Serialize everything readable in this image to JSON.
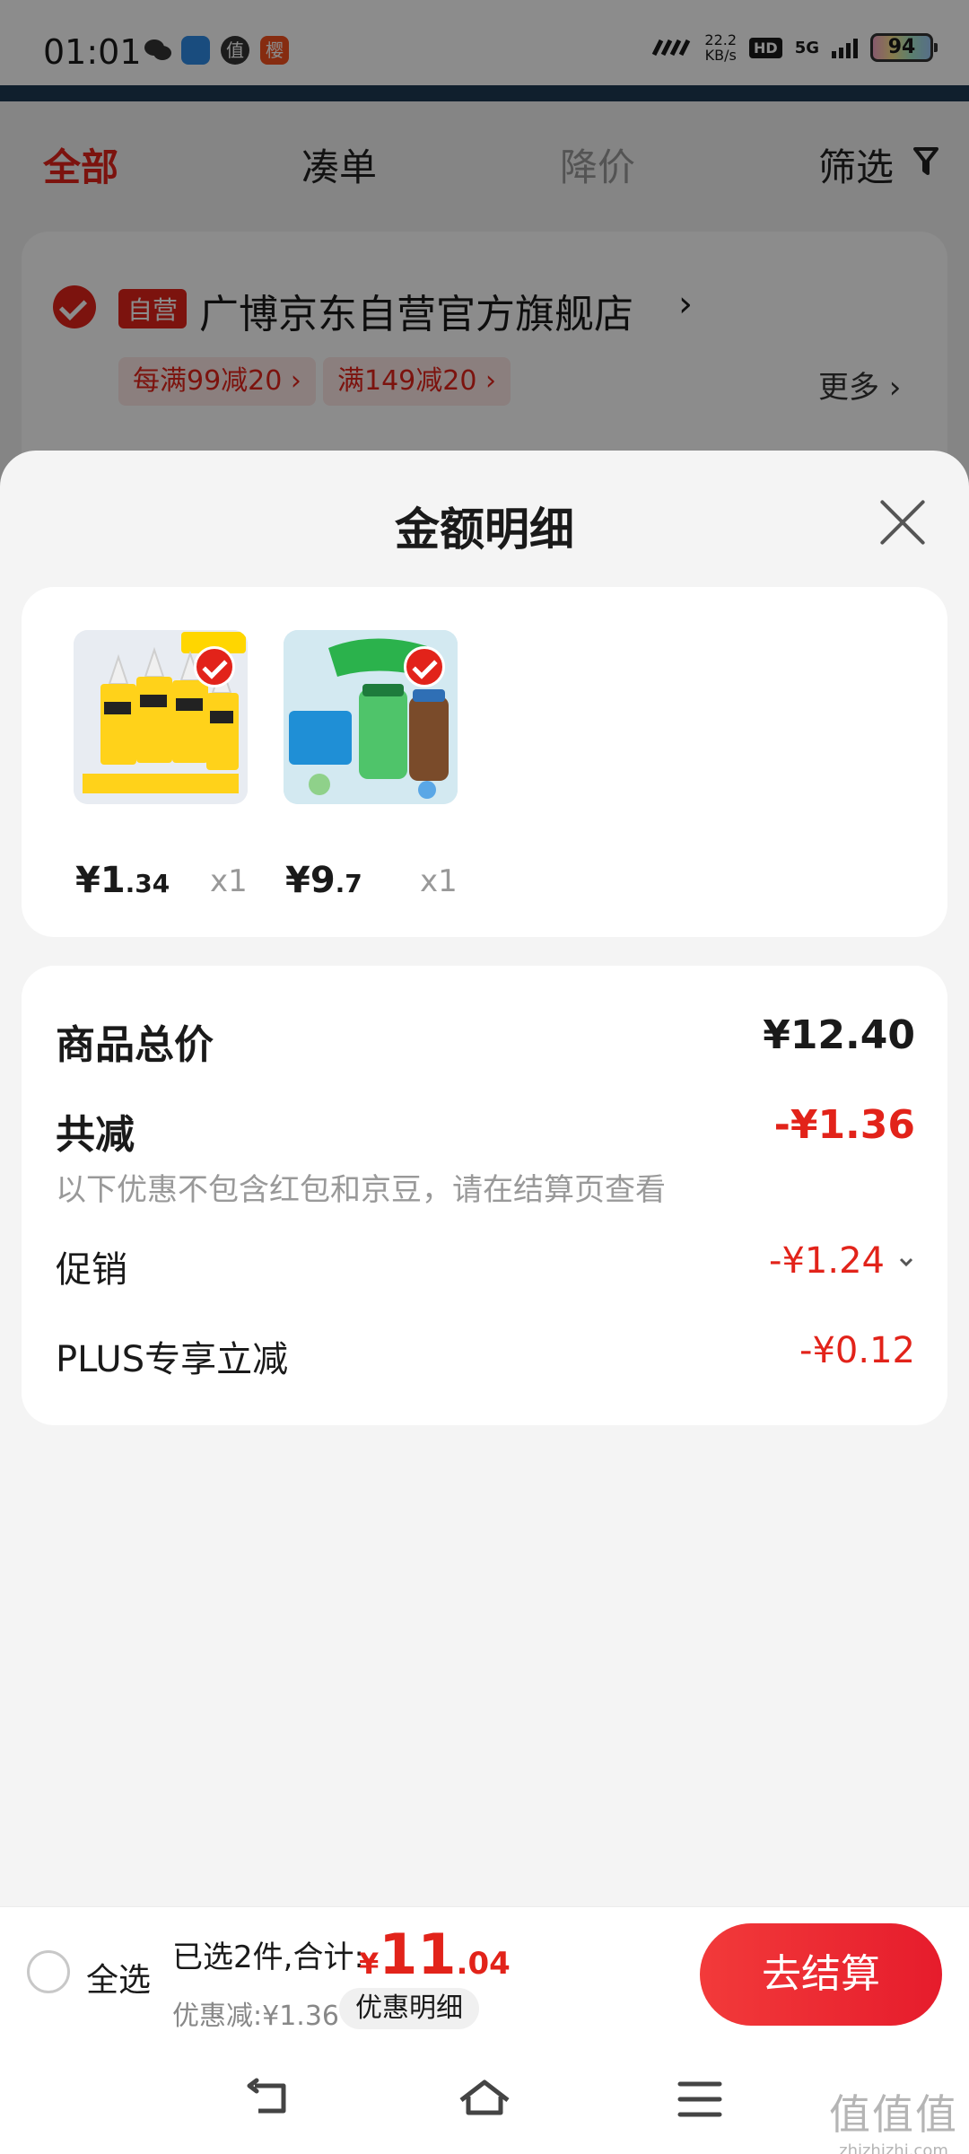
{
  "status_bar": {
    "time": "01:01",
    "net_speed_value": "22.2",
    "net_speed_unit": "KB/s",
    "hd": "HD",
    "network": "5G",
    "battery": "94",
    "app_icons": [
      "wechat-icon",
      "app-icon",
      "zhi-icon",
      "cherry-icon"
    ],
    "zhi_char": "值",
    "cherry_char": "樱"
  },
  "tabs": {
    "all": "全部",
    "combine": "凑单",
    "price_drop": "降价",
    "filter": "筛选"
  },
  "store": {
    "self_tag": "自营",
    "name": "广博京东自营官方旗舰店",
    "chevron": "›",
    "promo1": "每满99减20 ›",
    "promo2": "满149减20 ›",
    "more": "更多 ›"
  },
  "sheet": {
    "title": "金额明细",
    "products": [
      {
        "price_int": "¥1",
        "price_dec": ".34",
        "qty": "x1"
      },
      {
        "price_int": "¥9",
        "price_dec": ".7",
        "qty": "x1"
      }
    ],
    "summary": {
      "total_label": "商品总价",
      "total_value": "¥12.40",
      "reduce_label": "共减",
      "reduce_value": "-¥1.36",
      "note": "以下优惠不包含红包和京豆，请在结算页查看",
      "promo_label": "促销",
      "promo_value": "-¥1.24",
      "plus_label": "PLUS专享立减",
      "plus_value": "-¥0.12"
    }
  },
  "checkout": {
    "select_all": "全选",
    "selected_info": "已选2件,合计:",
    "total_currency": "¥",
    "total_int": "11",
    "total_dec": ".04",
    "discount": "优惠减:¥1.36",
    "detail_chip": "优惠明细",
    "button": "去结算"
  },
  "watermark": {
    "main": "值值值",
    "sub": "zhizhizhi.com"
  },
  "colors": {
    "accent": "#e2231a",
    "text": "#1a1a1a",
    "muted": "#999999"
  }
}
